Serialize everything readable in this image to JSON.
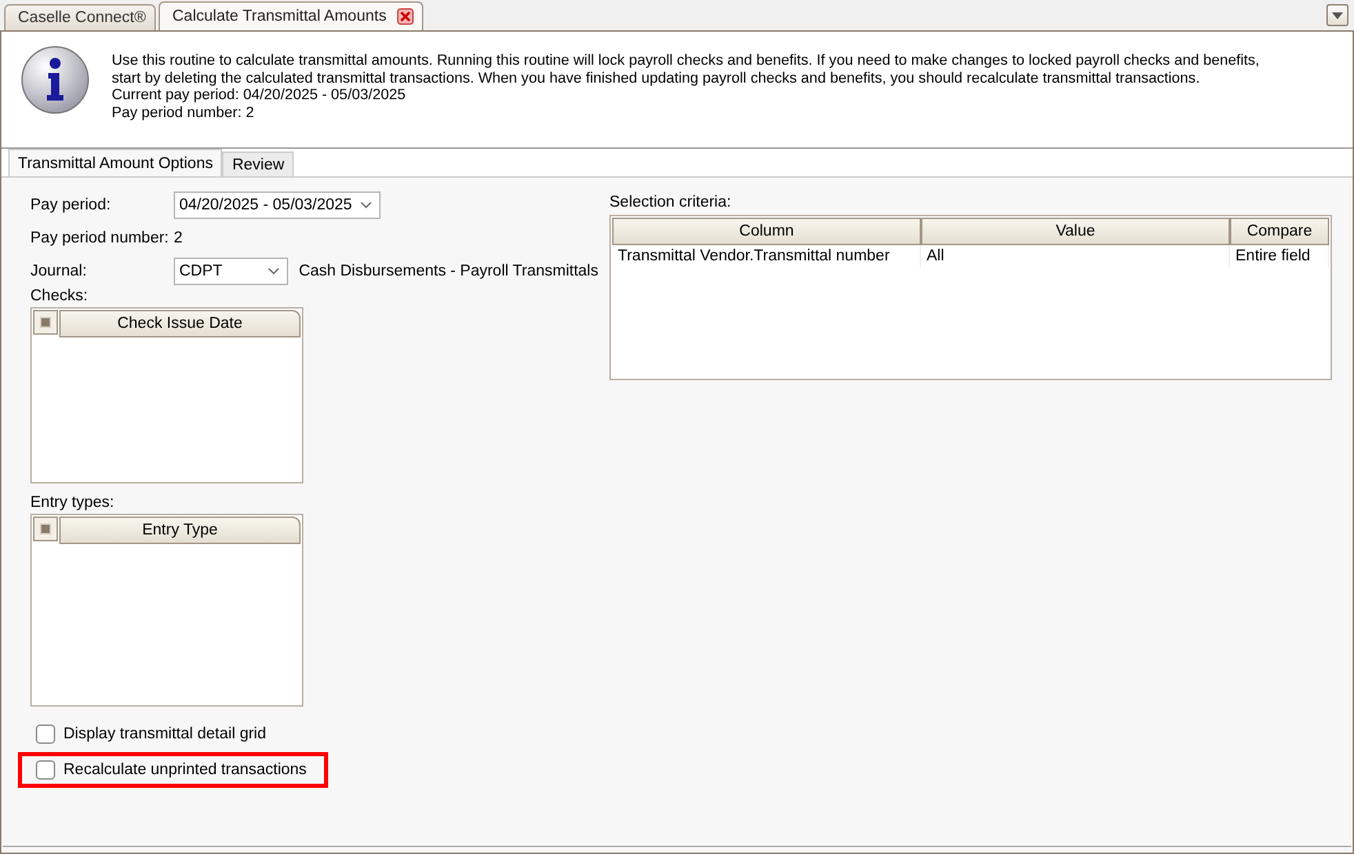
{
  "doc_tabs": [
    {
      "label": "Caselle Connect®",
      "selected": false,
      "closable": false
    },
    {
      "label": "Calculate Transmittal Amounts",
      "selected": true,
      "closable": true
    }
  ],
  "info": {
    "lines": [
      "Use this routine to calculate transmittal amounts. Running this routine will lock payroll checks and benefits. If you need to make changes to locked payroll checks and benefits,",
      "start by deleting the calculated transmittal transactions. When you have finished updating payroll checks and benefits, you should recalculate transmittal transactions.",
      "Current pay period: 04/20/2025 - 05/03/2025",
      "Pay period number: 2"
    ]
  },
  "tabs": [
    {
      "label": "Transmittal Amount Options",
      "selected": true
    },
    {
      "label": "Review",
      "selected": false
    }
  ],
  "form": {
    "pay_period": {
      "label": "Pay period:",
      "value": "04/20/2025 - 05/03/2025"
    },
    "pay_period_number": {
      "label": "Pay period number:",
      "value": "2"
    },
    "journal": {
      "label": "Journal:",
      "value": "CDPT",
      "description": "Cash Disbursements - Payroll Transmittals"
    },
    "checks": {
      "label": "Checks:",
      "column": "Check Issue Date"
    },
    "entry_types": {
      "label": "Entry types:",
      "column": "Entry Type"
    },
    "options": [
      {
        "label": "Display transmittal detail grid",
        "checked": false,
        "highlighted": false
      },
      {
        "label": "Recalculate unprinted transactions",
        "checked": false,
        "highlighted": true
      }
    ]
  },
  "selection_criteria": {
    "label": "Selection criteria:",
    "columns": [
      "Column",
      "Value",
      "Compare"
    ],
    "rows": [
      [
        "Transmittal Vendor.Transmittal number",
        "All",
        "Entire field"
      ]
    ]
  }
}
